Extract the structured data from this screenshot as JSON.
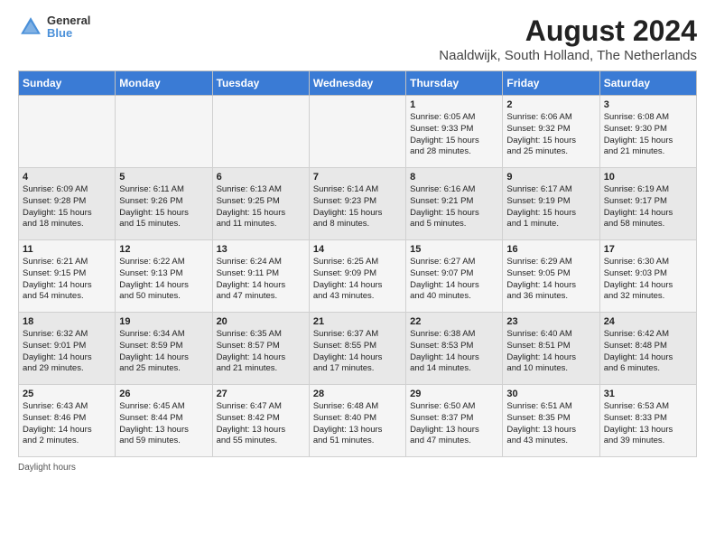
{
  "logo": {
    "line1": "General",
    "line2": "Blue"
  },
  "title": "August 2024",
  "subtitle": "Naaldwijk, South Holland, The Netherlands",
  "days_of_week": [
    "Sunday",
    "Monday",
    "Tuesday",
    "Wednesday",
    "Thursday",
    "Friday",
    "Saturday"
  ],
  "footer": "Daylight hours",
  "weeks": [
    [
      {
        "num": "",
        "info": ""
      },
      {
        "num": "",
        "info": ""
      },
      {
        "num": "",
        "info": ""
      },
      {
        "num": "",
        "info": ""
      },
      {
        "num": "1",
        "info": "Sunrise: 6:05 AM\nSunset: 9:33 PM\nDaylight: 15 hours\nand 28 minutes."
      },
      {
        "num": "2",
        "info": "Sunrise: 6:06 AM\nSunset: 9:32 PM\nDaylight: 15 hours\nand 25 minutes."
      },
      {
        "num": "3",
        "info": "Sunrise: 6:08 AM\nSunset: 9:30 PM\nDaylight: 15 hours\nand 21 minutes."
      }
    ],
    [
      {
        "num": "4",
        "info": "Sunrise: 6:09 AM\nSunset: 9:28 PM\nDaylight: 15 hours\nand 18 minutes."
      },
      {
        "num": "5",
        "info": "Sunrise: 6:11 AM\nSunset: 9:26 PM\nDaylight: 15 hours\nand 15 minutes."
      },
      {
        "num": "6",
        "info": "Sunrise: 6:13 AM\nSunset: 9:25 PM\nDaylight: 15 hours\nand 11 minutes."
      },
      {
        "num": "7",
        "info": "Sunrise: 6:14 AM\nSunset: 9:23 PM\nDaylight: 15 hours\nand 8 minutes."
      },
      {
        "num": "8",
        "info": "Sunrise: 6:16 AM\nSunset: 9:21 PM\nDaylight: 15 hours\nand 5 minutes."
      },
      {
        "num": "9",
        "info": "Sunrise: 6:17 AM\nSunset: 9:19 PM\nDaylight: 15 hours\nand 1 minute."
      },
      {
        "num": "10",
        "info": "Sunrise: 6:19 AM\nSunset: 9:17 PM\nDaylight: 14 hours\nand 58 minutes."
      }
    ],
    [
      {
        "num": "11",
        "info": "Sunrise: 6:21 AM\nSunset: 9:15 PM\nDaylight: 14 hours\nand 54 minutes."
      },
      {
        "num": "12",
        "info": "Sunrise: 6:22 AM\nSunset: 9:13 PM\nDaylight: 14 hours\nand 50 minutes."
      },
      {
        "num": "13",
        "info": "Sunrise: 6:24 AM\nSunset: 9:11 PM\nDaylight: 14 hours\nand 47 minutes."
      },
      {
        "num": "14",
        "info": "Sunrise: 6:25 AM\nSunset: 9:09 PM\nDaylight: 14 hours\nand 43 minutes."
      },
      {
        "num": "15",
        "info": "Sunrise: 6:27 AM\nSunset: 9:07 PM\nDaylight: 14 hours\nand 40 minutes."
      },
      {
        "num": "16",
        "info": "Sunrise: 6:29 AM\nSunset: 9:05 PM\nDaylight: 14 hours\nand 36 minutes."
      },
      {
        "num": "17",
        "info": "Sunrise: 6:30 AM\nSunset: 9:03 PM\nDaylight: 14 hours\nand 32 minutes."
      }
    ],
    [
      {
        "num": "18",
        "info": "Sunrise: 6:32 AM\nSunset: 9:01 PM\nDaylight: 14 hours\nand 29 minutes."
      },
      {
        "num": "19",
        "info": "Sunrise: 6:34 AM\nSunset: 8:59 PM\nDaylight: 14 hours\nand 25 minutes."
      },
      {
        "num": "20",
        "info": "Sunrise: 6:35 AM\nSunset: 8:57 PM\nDaylight: 14 hours\nand 21 minutes."
      },
      {
        "num": "21",
        "info": "Sunrise: 6:37 AM\nSunset: 8:55 PM\nDaylight: 14 hours\nand 17 minutes."
      },
      {
        "num": "22",
        "info": "Sunrise: 6:38 AM\nSunset: 8:53 PM\nDaylight: 14 hours\nand 14 minutes."
      },
      {
        "num": "23",
        "info": "Sunrise: 6:40 AM\nSunset: 8:51 PM\nDaylight: 14 hours\nand 10 minutes."
      },
      {
        "num": "24",
        "info": "Sunrise: 6:42 AM\nSunset: 8:48 PM\nDaylight: 14 hours\nand 6 minutes."
      }
    ],
    [
      {
        "num": "25",
        "info": "Sunrise: 6:43 AM\nSunset: 8:46 PM\nDaylight: 14 hours\nand 2 minutes."
      },
      {
        "num": "26",
        "info": "Sunrise: 6:45 AM\nSunset: 8:44 PM\nDaylight: 13 hours\nand 59 minutes."
      },
      {
        "num": "27",
        "info": "Sunrise: 6:47 AM\nSunset: 8:42 PM\nDaylight: 13 hours\nand 55 minutes."
      },
      {
        "num": "28",
        "info": "Sunrise: 6:48 AM\nSunset: 8:40 PM\nDaylight: 13 hours\nand 51 minutes."
      },
      {
        "num": "29",
        "info": "Sunrise: 6:50 AM\nSunset: 8:37 PM\nDaylight: 13 hours\nand 47 minutes."
      },
      {
        "num": "30",
        "info": "Sunrise: 6:51 AM\nSunset: 8:35 PM\nDaylight: 13 hours\nand 43 minutes."
      },
      {
        "num": "31",
        "info": "Sunrise: 6:53 AM\nSunset: 8:33 PM\nDaylight: 13 hours\nand 39 minutes."
      }
    ]
  ]
}
